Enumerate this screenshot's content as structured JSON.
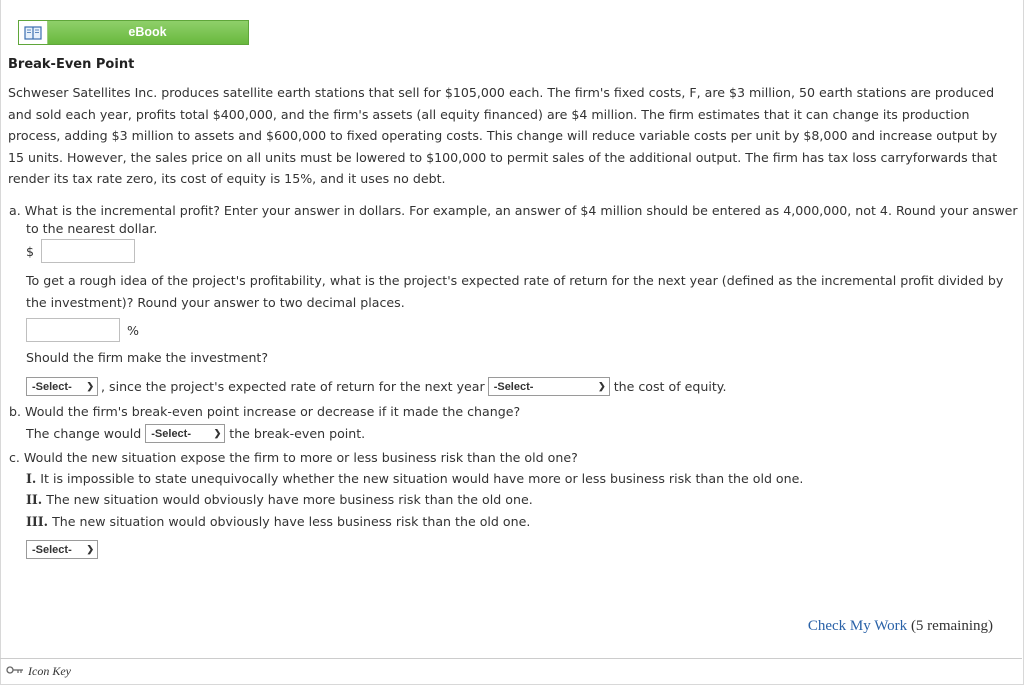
{
  "ebook": {
    "label": "eBook"
  },
  "title": "Break-Even Point",
  "problem": "Schweser Satellites Inc. produces satellite earth stations that sell for $105,000 each. The firm's fixed costs, F, are $3 million, 50 earth stations are produced and sold each year, profits total $400,000, and the firm's assets (all equity financed) are $4 million. The firm estimates that it can change its production process, adding $3 million to assets and $600,000 to fixed operating costs. This change will reduce variable costs per unit by $8,000 and increase output by 15 units. However, the sales price on all units must be lowered to $100,000 to permit sales of the additional output. The firm has tax loss carryforwards that render its tax rate zero, its cost of equity is 15%, and it uses no debt.",
  "qa": {
    "q_text": "a. What is the incremental profit? Enter your answer in dollars. For example, an answer of $4 million should be entered as 4,000,000, not 4. Round your answer",
    "q_text2": "to the nearest dollar.",
    "currency": "$",
    "rate_question": "To get a rough idea of the project's profitability, what is the project's expected rate of return for the next year (defined as the incremental profit divided by",
    "rate_question2": "the investment)? Round your answer to two decimal places.",
    "percent": "%",
    "invest_question": "Should the firm make the investment?",
    "select_default": "-Select-",
    "since_text": ", since the project's expected rate of return for the next year",
    "cost_text": "the cost of equity."
  },
  "qb": {
    "question": "b. Would the firm's break-even point increase or decrease if it made the change?",
    "prefix": "The change would",
    "suffix": "the break-even point."
  },
  "qc": {
    "question": "c. Would the new situation expose the firm to more or less business risk than the old one?",
    "options": [
      {
        "num": "I.",
        "text": "It is impossible to state unequivocally whether the new situation would have more or less business risk than the old one."
      },
      {
        "num": "II.",
        "text": "The new situation would obviously have more business risk than the old one."
      },
      {
        "num": "III.",
        "text": "The new situation would obviously have less business risk than the old one."
      }
    ]
  },
  "footer": {
    "check_link": "Check My Work",
    "remaining": "(5 remaining)",
    "icon_key": "Icon Key"
  }
}
